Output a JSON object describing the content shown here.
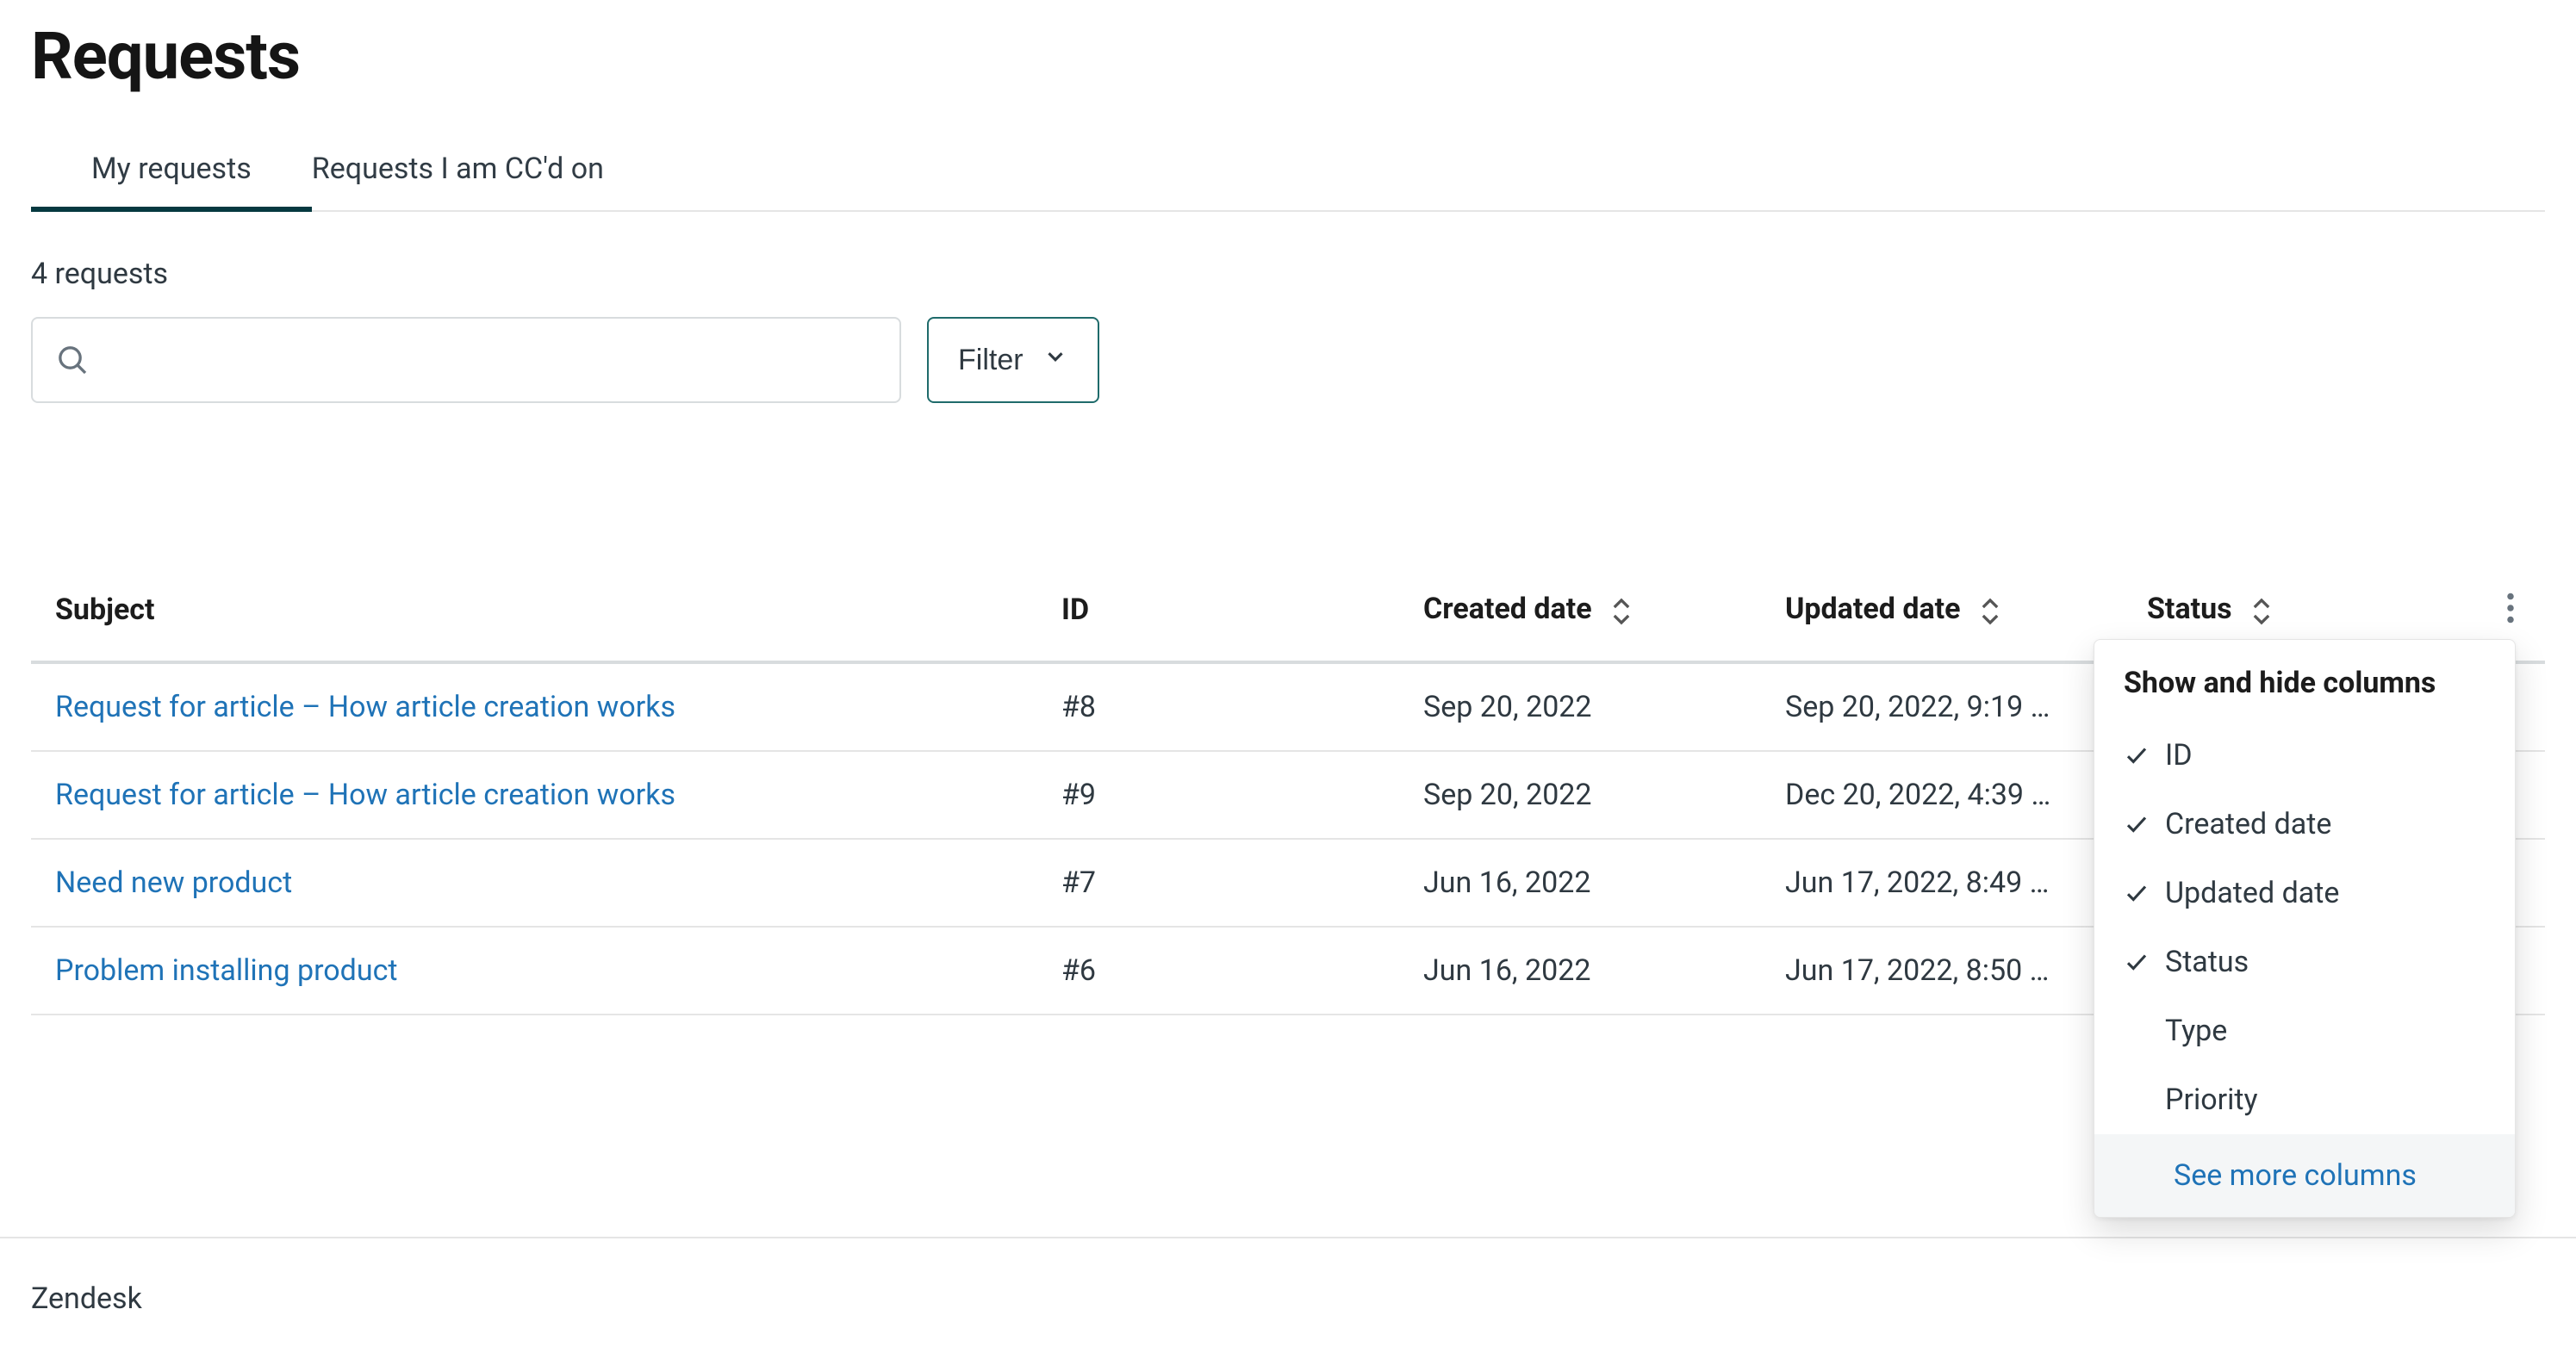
{
  "page": {
    "title": "Requests",
    "summary": "4 requests",
    "footer": "Zendesk"
  },
  "tabs": {
    "my_requests": "My requests",
    "cc_requests": "Requests I am CC'd on"
  },
  "controls": {
    "search_value": "",
    "filter_label": "Filter"
  },
  "table": {
    "columns": {
      "subject": "Subject",
      "id": "ID",
      "created": "Created date",
      "updated": "Updated date",
      "status": "Status"
    },
    "rows": [
      {
        "subject": "Request for article – How article creation works",
        "id": "#8",
        "created": "Sep 20, 2022",
        "updated": "Sep 20, 2022, 9:19 …"
      },
      {
        "subject": "Request for article – How article creation works",
        "id": "#9",
        "created": "Sep 20, 2022",
        "updated": "Dec 20, 2022, 4:39 …"
      },
      {
        "subject": "Need new product",
        "id": "#7",
        "created": "Jun 16, 2022",
        "updated": "Jun 17, 2022, 8:49 …"
      },
      {
        "subject": "Problem installing product",
        "id": "#6",
        "created": "Jun 16, 2022",
        "updated": "Jun 17, 2022, 8:50 …"
      }
    ]
  },
  "dropdown": {
    "title": "Show and hide columns",
    "items": [
      {
        "label": "ID",
        "checked": true
      },
      {
        "label": "Created date",
        "checked": true
      },
      {
        "label": "Updated date",
        "checked": true
      },
      {
        "label": "Status",
        "checked": true
      },
      {
        "label": "Type",
        "checked": false
      },
      {
        "label": "Priority",
        "checked": false
      }
    ],
    "footer": "See more columns"
  }
}
